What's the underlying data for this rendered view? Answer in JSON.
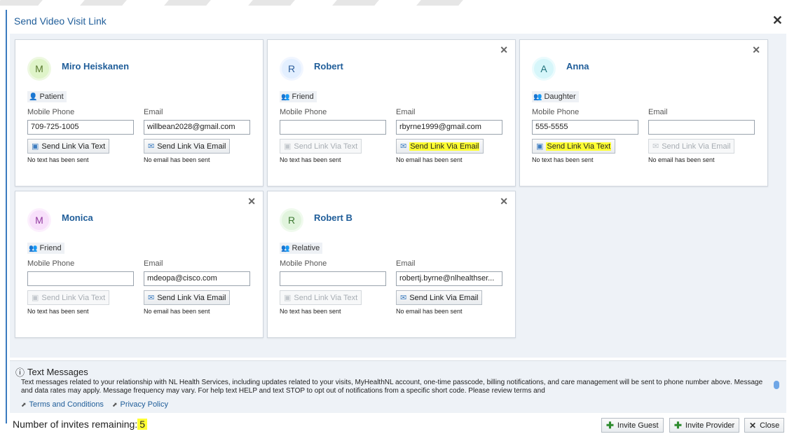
{
  "dialog": {
    "title": "Send Video Visit Link"
  },
  "cards": [
    {
      "initial": "M",
      "name": "Miro Heiskanen",
      "relationship": "Patient",
      "mobile_label": "Mobile Phone",
      "email_label": "Email",
      "mobile_value": "709-725-1005",
      "email_value": "willbean2028@gmail.com",
      "text_btn": "Send Link Via Text",
      "email_btn": "Send Link Via Email",
      "text_status": "No text has been sent",
      "email_status": "No email has been sent"
    },
    {
      "initial": "R",
      "name": "Robert",
      "relationship": "Friend",
      "mobile_label": "Mobile Phone",
      "email_label": "Email",
      "mobile_value": "",
      "email_value": "rbyrne1999@gmail.com",
      "text_btn": "Send Link Via Text",
      "email_btn": "Send Link Via Email",
      "text_status": "No text has been sent",
      "email_status": "No email has been sent"
    },
    {
      "initial": "A",
      "name": "Anna",
      "relationship": "Daughter",
      "mobile_label": "Mobile Phone",
      "email_label": "Email",
      "mobile_value": "555-5555",
      "email_value": "",
      "text_btn": "Send Link Via Text",
      "email_btn": "Send Link Via Email",
      "text_status": "No text has been sent",
      "email_status": "No email has been sent"
    },
    {
      "initial": "M",
      "name": "Monica",
      "relationship": "Friend",
      "mobile_label": "Mobile Phone",
      "email_label": "Email",
      "mobile_value": "",
      "email_value": "mdeopa@cisco.com",
      "text_btn": "Send Link Via Text",
      "email_btn": "Send Link Via Email",
      "text_status": "No text has been sent",
      "email_status": "No email has been sent"
    },
    {
      "initial": "R",
      "name": "Robert B",
      "relationship": "Relative",
      "mobile_label": "Mobile Phone",
      "email_label": "Email",
      "mobile_value": "",
      "email_value": "robertj.byrne@nlhealthser...",
      "text_btn": "Send Link Via Text",
      "email_btn": "Send Link Via Email",
      "text_status": "No text has been sent",
      "email_status": "No email has been sent"
    }
  ],
  "text_messages": {
    "title": "Text Messages",
    "body": "Text messages related to your relationship with NL Health Services, including updates related to your visits, MyHealthNL account, one-time passcode, billing notifications, and care management will be sent to phone number above. Message and data rates may apply. Message frequency may vary. For help text HELP and text STOP to opt out of notifications from a specific short code. Please review terms and",
    "terms_link": "Terms and Conditions",
    "privacy_link": "Privacy Policy"
  },
  "footer": {
    "remaining_label": "Number of invites remaining:",
    "remaining_count": "5",
    "invite_guest": "Invite Guest",
    "invite_provider": "Invite Provider",
    "close": "Close"
  },
  "colors": {
    "accent": "#1f5d99",
    "highlight": "#ffff33",
    "panel_bg": "#eef2f7"
  }
}
